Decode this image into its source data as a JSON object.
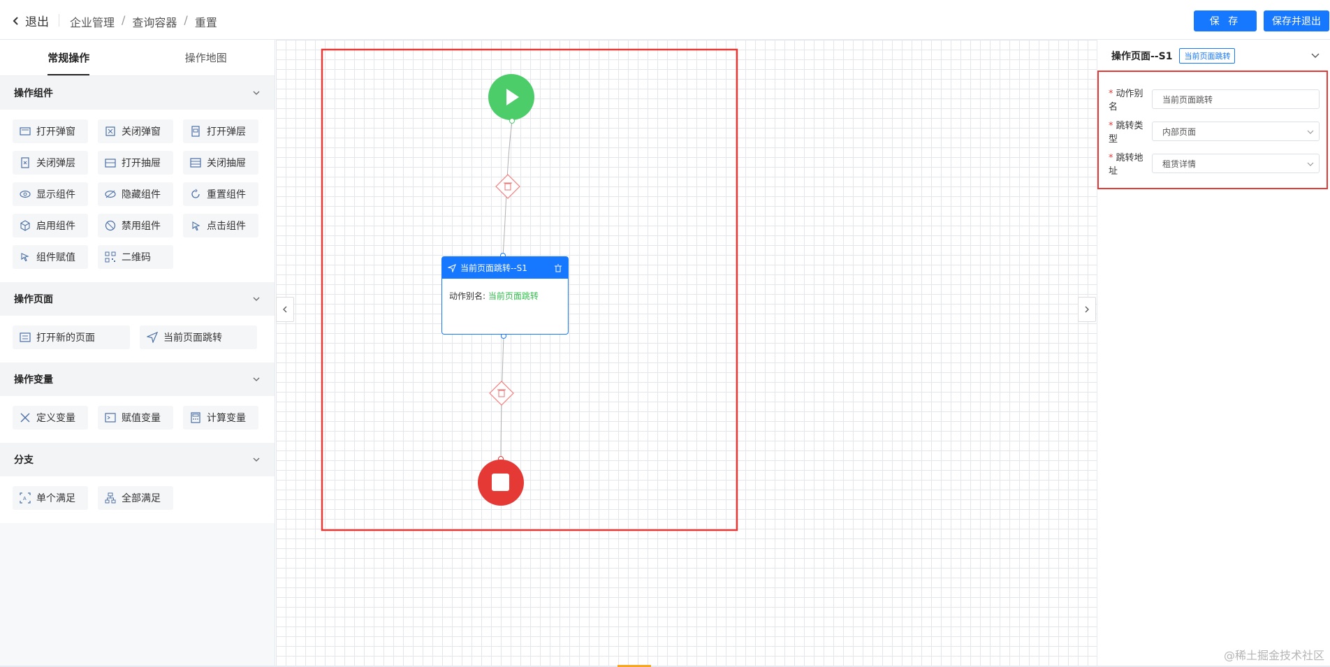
{
  "header": {
    "exit_label": "退出",
    "breadcrumbs": [
      "企业管理",
      "查询容器",
      "重置"
    ],
    "save_label": "保 存",
    "save_exit_label": "保存并退出"
  },
  "left_panel": {
    "tabs": [
      "常规操作",
      "操作地图"
    ],
    "sections": [
      {
        "title": "操作组件",
        "items": [
          "打开弹窗",
          "关闭弹窗",
          "打开弹层",
          "关闭弹层",
          "打开抽屉",
          "关闭抽屉",
          "显示组件",
          "隐藏组件",
          "重置组件",
          "启用组件",
          "禁用组件",
          "点击组件",
          "组件赋值",
          "二维码"
        ]
      },
      {
        "title": "操作页面",
        "items": [
          "打开新的页面",
          "当前页面跳转"
        ]
      },
      {
        "title": "操作变量",
        "items": [
          "定义变量",
          "赋值变量",
          "计算变量"
        ]
      },
      {
        "title": "分支",
        "items": [
          "单个满足",
          "全部满足"
        ]
      }
    ]
  },
  "canvas": {
    "node": {
      "title": "当前页面跳转--S1",
      "alias_label": "动作别名:",
      "alias_value": "当前页面跳转"
    }
  },
  "right_panel": {
    "title": "操作页面--S1",
    "badge": "当前页面跳转",
    "fields": [
      {
        "label": "动作别名",
        "value": "当前页面跳转"
      },
      {
        "label": "跳转类型",
        "value": "内部页面"
      },
      {
        "label": "跳转地址",
        "value": "租赁详情"
      }
    ]
  },
  "watermark": "@稀土掘金技术社区",
  "colors": {
    "primary": "#1677ff",
    "start": "#4ccd6a",
    "end": "#e53935",
    "highlight": "#e53935"
  }
}
